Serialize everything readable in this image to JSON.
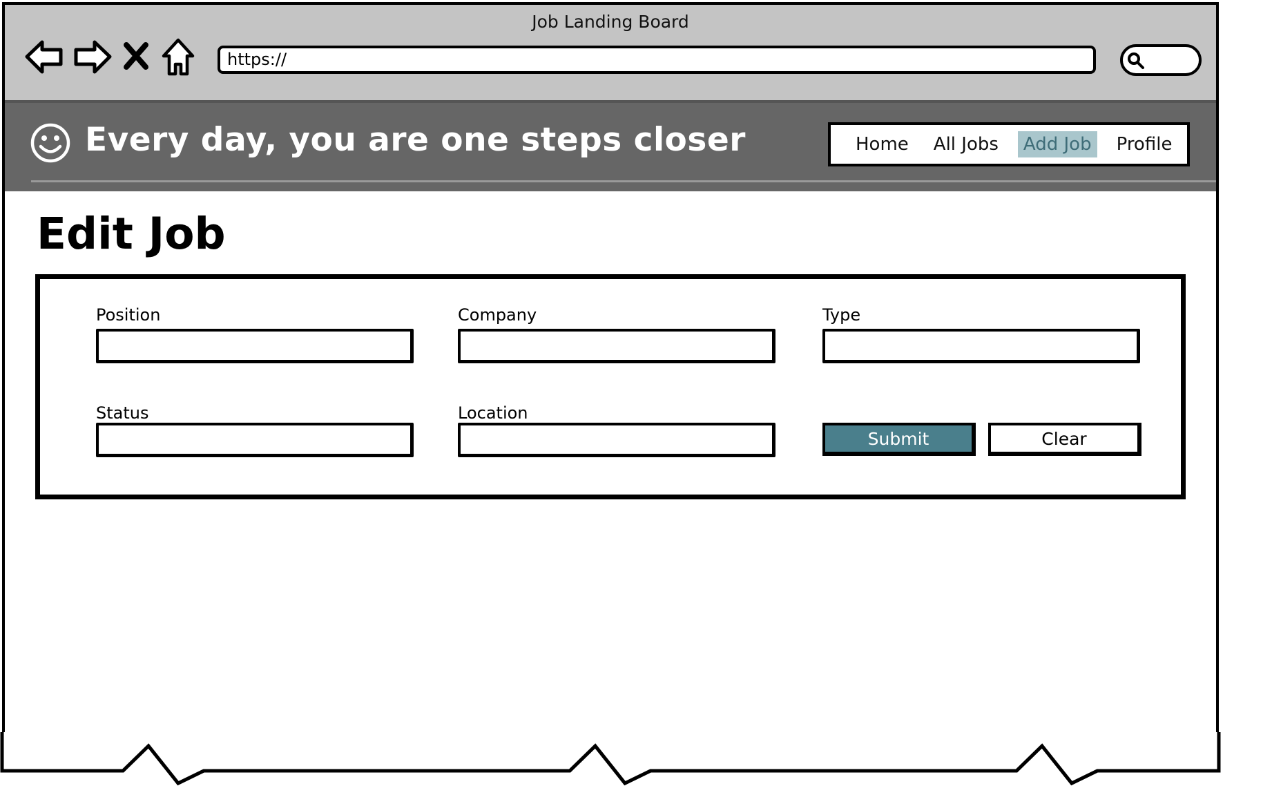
{
  "window": {
    "title": "Job Landing Board"
  },
  "browser": {
    "url": "https://",
    "icons": [
      "back-arrow-icon",
      "forward-arrow-icon",
      "close-icon",
      "home-icon",
      "search-icon"
    ]
  },
  "header": {
    "tagline": "Every day, you are one steps closer",
    "logo_icon": "smiley-icon",
    "nav": [
      {
        "label": "Home",
        "active": false
      },
      {
        "label": "All Jobs",
        "active": false
      },
      {
        "label": "Add Job",
        "active": true
      },
      {
        "label": "Profile",
        "active": false
      }
    ]
  },
  "main": {
    "title": "Edit Job",
    "form": {
      "position_label": "Position",
      "company_label": "Company",
      "type_label": "Type",
      "status_label": "Status",
      "location_label": "Location",
      "position_value": "",
      "company_value": "",
      "type_value": "",
      "status_value": "",
      "location_value": "",
      "submit_label": "Submit",
      "clear_label": "Clear"
    }
  },
  "colors": {
    "titlebar": "#c4c4c4",
    "banner": "#666666",
    "active_nav_bg": "#a9c6cc",
    "submit_bg": "#4a7f8c"
  }
}
